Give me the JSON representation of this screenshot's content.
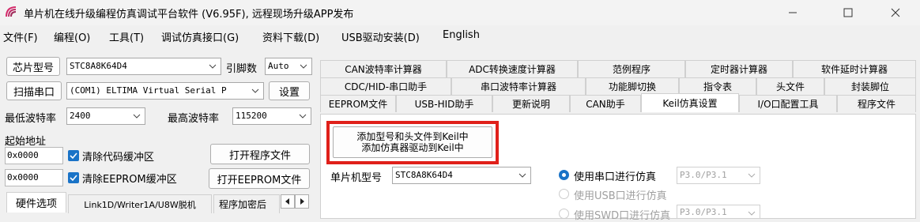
{
  "window": {
    "title": "单片机在线升级编程仿真调试平台软件 (V6.95F), 远程现场升级APP发布"
  },
  "menu": [
    "文件(F)",
    "编程(O)",
    "工具(T)",
    "调试仿真接口(G)",
    "资料下载(D)",
    "USB驱动安装(D)",
    "English"
  ],
  "left": {
    "chip_button": "芯片型号",
    "chip_value": "STC8A8K64D4",
    "pin_label": "引脚数",
    "pin_value": "Auto",
    "scan_button": "扫描串口",
    "port_value": "(COM1) ELTIMA Virtual Serial P",
    "settings_button": "设置",
    "min_baud_label": "最低波特率",
    "min_baud_value": "2400",
    "max_baud_label": "最高波特率",
    "max_baud_value": "115200",
    "start_addr_label": "起始地址",
    "addr1_value": "0x0000",
    "clear_code_label": "清除代码缓冲区",
    "open_program_button": "打开程序文件",
    "addr2_value": "0x0000",
    "clear_eeprom_label": "清除EEPROM缓冲区",
    "open_eeprom_button": "打开EEPROM文件",
    "bottom_tabs": [
      "硬件选项",
      "Link1D/Writer1A/U8W脱机",
      "程序加密后"
    ]
  },
  "tabs": {
    "row1": [
      "CAN波特率计算器",
      "ADC转换速度计算器",
      "范例程序",
      "定时器计算器",
      "软件延时计算器"
    ],
    "row2": [
      "CDC/HID-串口助手",
      "串口波特率计算器",
      "功能脚切换",
      "指令表",
      "头文件",
      "封装脚位"
    ],
    "row3": [
      "EEPROM文件",
      "USB-HID助手",
      "更新说明",
      "CAN助手",
      "Keil仿真设置",
      "I/O口配置工具",
      "程序文件"
    ]
  },
  "keil": {
    "add_button_line1": "添加型号和头文件到Keil中",
    "add_button_line2": "添加仿真器驱动到Keil中",
    "mcu_label": "单片机型号",
    "mcu_value": "STC8A8K64D4",
    "radio_serial": "使用串口进行仿真",
    "serial_port_value": "P3.0/P3.1",
    "radio_usb": "使用USB口进行仿真",
    "radio_swd": "使用SWD口进行仿真",
    "swd_value": "P3.0/P3.1"
  },
  "colors": {
    "accent": "#1a73c7",
    "highlight": "#e0201a"
  }
}
